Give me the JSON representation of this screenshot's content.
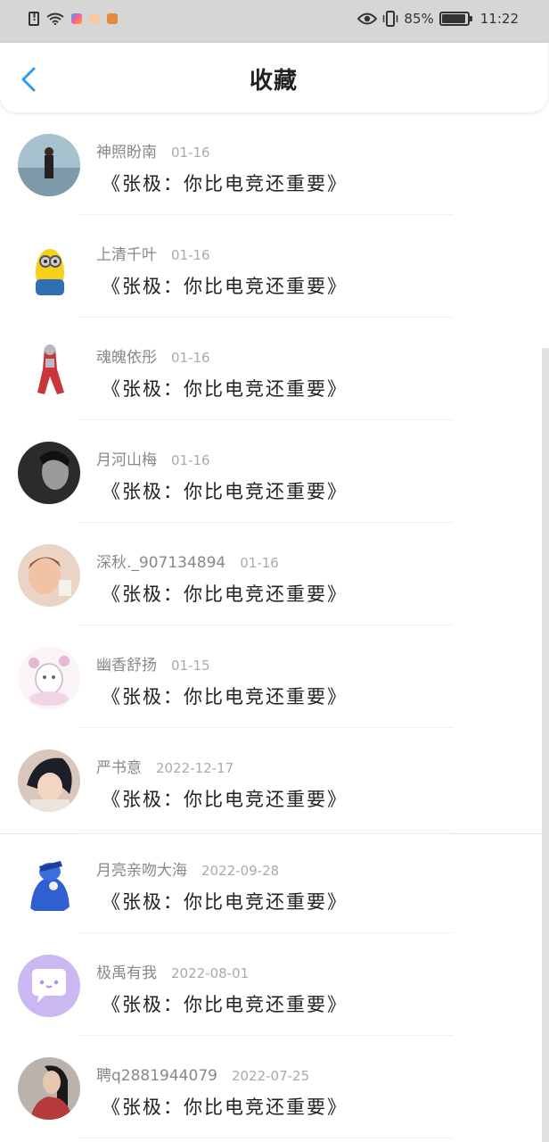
{
  "status_bar": {
    "battery_percent": "85%",
    "time": "11:22"
  },
  "header": {
    "title": "收藏"
  },
  "items": [
    {
      "author": "神照盼南",
      "date": "01-16",
      "title": "《张极：你比电竞还重要》"
    },
    {
      "author": "上清千叶",
      "date": "01-16",
      "title": "《张极：你比电竞还重要》"
    },
    {
      "author": "魂魄依彤",
      "date": "01-16",
      "title": "《张极：你比电竞还重要》"
    },
    {
      "author": "月河山梅",
      "date": "01-16",
      "title": "《张极：你比电竞还重要》"
    },
    {
      "author": "深秋._907134894",
      "date": "01-16",
      "title": "《张极：你比电竞还重要》"
    },
    {
      "author": "幽香舒扬",
      "date": "01-15",
      "title": "《张极：你比电竞还重要》"
    },
    {
      "author": "严书意",
      "date": "2022-12-17",
      "title": "《张极：你比电竞还重要》"
    },
    {
      "author": "月亮亲吻大海",
      "date": "2022-09-28",
      "title": "《张极：你比电竞还重要》"
    },
    {
      "author": "极禹有我",
      "date": "2022-08-01",
      "title": "《张极：你比电竞还重要》"
    },
    {
      "author": "聘q2881944079",
      "date": "2022-07-25",
      "title": "《张极：你比电竞还重要》"
    }
  ],
  "colors": {
    "accent": "#2a9bf5",
    "status_bar_bg": "#d6d6d6"
  }
}
